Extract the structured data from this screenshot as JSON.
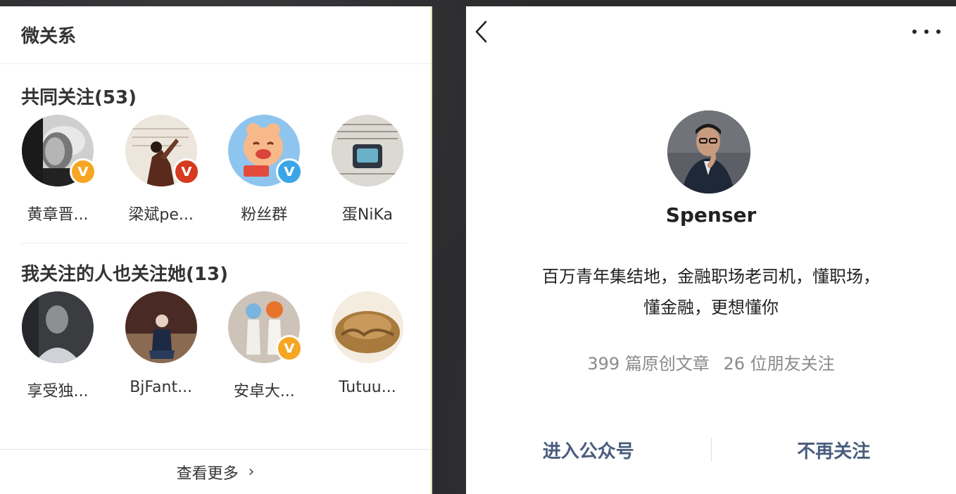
{
  "left": {
    "title": "微关系",
    "common_follow": {
      "title": "共同关注(53)",
      "users": [
        {
          "name": "黄章晋...",
          "badge": "V",
          "badge_color": "gold"
        },
        {
          "name": "梁斌pe...",
          "badge": "V",
          "badge_color": "red"
        },
        {
          "name": "粉丝群",
          "badge": "V",
          "badge_color": "blue"
        },
        {
          "name": "蛋NiKa",
          "badge": "",
          "badge_color": ""
        }
      ]
    },
    "also_follow": {
      "title": "我关注的人也关注她(13)",
      "users": [
        {
          "name": "享受独...",
          "badge": "",
          "badge_color": ""
        },
        {
          "name": "BjFant...",
          "badge": "",
          "badge_color": ""
        },
        {
          "name": "安卓大...",
          "badge": "V",
          "badge_color": "gold"
        },
        {
          "name": "Tutuu...",
          "badge": "",
          "badge_color": ""
        }
      ]
    },
    "more_label": "查看更多",
    "more_chevron": "›"
  },
  "right": {
    "back_icon": "chevron-left-icon",
    "more_icon": "more-dots-icon",
    "name": "Spenser",
    "desc_line1": "百万青年集结地，金融职场老司机，懂职场，",
    "desc_line2": "懂金融，更想懂你",
    "articles": "399 篇原创文章",
    "friends": "26 位朋友关注",
    "enter_label": "进入公众号",
    "unfollow_label": "不再关注"
  },
  "colors": {
    "badge_gold": "#f6a623",
    "badge_red": "#d63a1f",
    "badge_blue": "#3ba5e8",
    "action_text": "#4a5d7e"
  }
}
